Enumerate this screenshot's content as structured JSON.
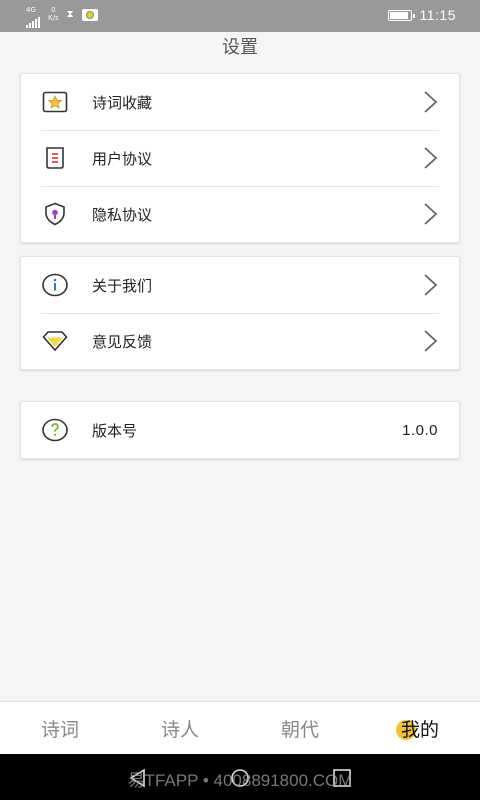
{
  "status_bar": {
    "network": "4G",
    "speed_value": "0",
    "speed_unit": "K/s",
    "hourglass_icon": "hourglass-icon",
    "app_icon": "app-notification-icon",
    "battery_icon": "battery-icon",
    "battery_level": 0.9,
    "time": "11:15"
  },
  "header": {
    "title": "设置"
  },
  "groups": [
    {
      "items": [
        {
          "icon": "star-icon",
          "label": "诗词收藏"
        },
        {
          "icon": "document-icon",
          "label": "用户协议"
        },
        {
          "icon": "shield-icon",
          "label": "隐私协议"
        }
      ]
    },
    {
      "items": [
        {
          "icon": "info-icon",
          "label": "关于我们"
        },
        {
          "icon": "diamond-icon",
          "label": "意见反馈"
        }
      ]
    },
    {
      "items": [
        {
          "icon": "question-icon",
          "label": "版本号",
          "value": "1.0.0"
        }
      ]
    }
  ],
  "tabs": [
    {
      "label": "诗词",
      "active": false
    },
    {
      "label": "诗人",
      "active": false
    },
    {
      "label": "朝代",
      "active": false
    },
    {
      "label": "我的",
      "active": true
    }
  ],
  "watermark": "易TFAPP • 4008891800.COM",
  "colors": {
    "status_bar": "#999999",
    "accent_yellow": "#f2c23d",
    "accent_purple": "#9c3fcf",
    "accent_red": "#e0332c",
    "accent_green": "#7dbb2c",
    "accent_blue": "#2a7ad5"
  }
}
